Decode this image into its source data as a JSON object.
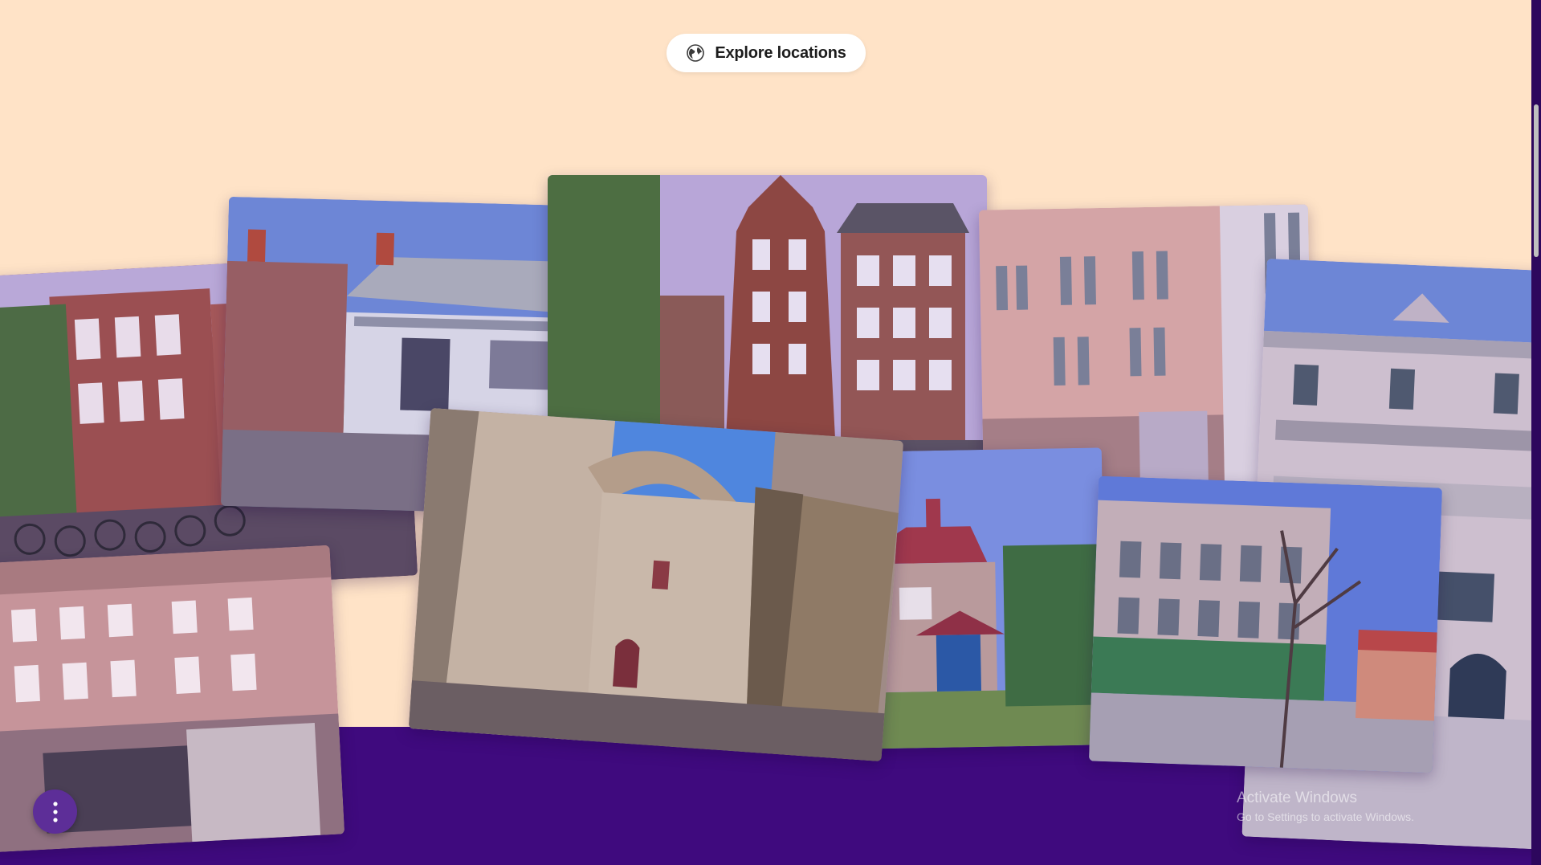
{
  "header": {
    "explore_label": "Explore locations",
    "explore_icon": "globe-icon"
  },
  "gallery": {
    "photos": [
      {
        "id": "amsterdam-canal-houses",
        "subject": "brick canal houses with bicycles"
      },
      {
        "id": "victorian-cottage",
        "subject": "white victorian house with veranda"
      },
      {
        "id": "dutch-gabled-facades",
        "subject": "stepped gable brick facades"
      },
      {
        "id": "pink-french-facade",
        "subject": "pink building with grey shutters"
      },
      {
        "id": "stone-classical-villa",
        "subject": "cream stone villa with balcony"
      },
      {
        "id": "pink-townhouses",
        "subject": "pink townhouses with balconies"
      },
      {
        "id": "stone-arch-village",
        "subject": "medieval stone arch passage"
      },
      {
        "id": "red-roof-house",
        "subject": "red roof house with blue door"
      },
      {
        "id": "ornate-mansion",
        "subject": "ornate french mansion with tree"
      }
    ]
  },
  "menu": {
    "icon": "vertical-dots-icon"
  },
  "os_overlay": {
    "line1": "Activate Windows",
    "line2": "Go to Settings to activate Windows."
  },
  "colors": {
    "background": "#ffe3c7",
    "band": "#3f0a7e",
    "fab": "#5d2e98",
    "pill": "#ffffff"
  }
}
